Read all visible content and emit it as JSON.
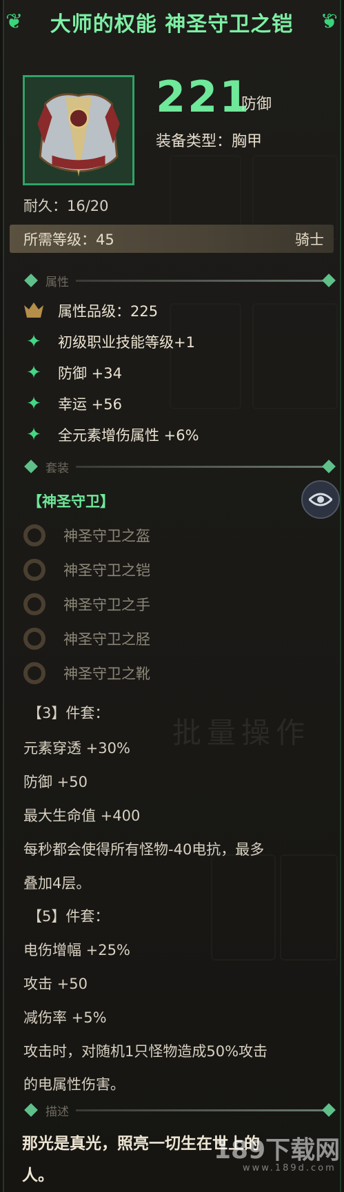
{
  "item": {
    "title": "大师的权能 神圣守卫之铠",
    "defense_value": "221",
    "defense_label": "防御",
    "equip_type": "装备类型：胸甲",
    "durability": "耐久：16/20",
    "required_level": "所需等级：45",
    "class": "骑士"
  },
  "sections": {
    "attributes": "属性",
    "set": "套装",
    "description": "描述"
  },
  "attributes": [
    {
      "icon": "crest-icon",
      "text": "属性品级：225"
    },
    {
      "icon": "sparkle-icon",
      "text": "初级职业技能等级+1"
    },
    {
      "icon": "sparkle-icon",
      "text": "防御 +34"
    },
    {
      "icon": "sparkle-icon",
      "text": "幸运 +56"
    },
    {
      "icon": "sparkle-icon",
      "text": "全元素增伤属性 +6%"
    }
  ],
  "set": {
    "name": "【神圣守卫】",
    "pieces": [
      "神圣守卫之盔",
      "神圣守卫之铠",
      "神圣守卫之手",
      "神圣守卫之胫",
      "神圣守卫之靴"
    ],
    "bonus3_header": "【3】件套：",
    "bonus3": [
      "元素穿透 +30%",
      "防御 +50",
      "最大生命值 +400",
      "每秒都会使得所有怪物-40电抗，最多",
      "叠加4层。"
    ],
    "bonus5_header": "【5】件套：",
    "bonus5": [
      "电伤增幅 +25%",
      "攻击 +50",
      "减伤率 +5%",
      "攻击时，对随机1只怪物造成50%攻击",
      "的电属性伤害。"
    ]
  },
  "description": [
    "那光是真光，照亮一切生在世上的",
    "人。"
  ],
  "background_text": "批量操作",
  "watermark": {
    "logo": "189下载网",
    "url": "www.189d.com"
  },
  "colors": {
    "accent": "#6fe89a",
    "frame": "#2fa465",
    "text": "#d8d1c2"
  }
}
